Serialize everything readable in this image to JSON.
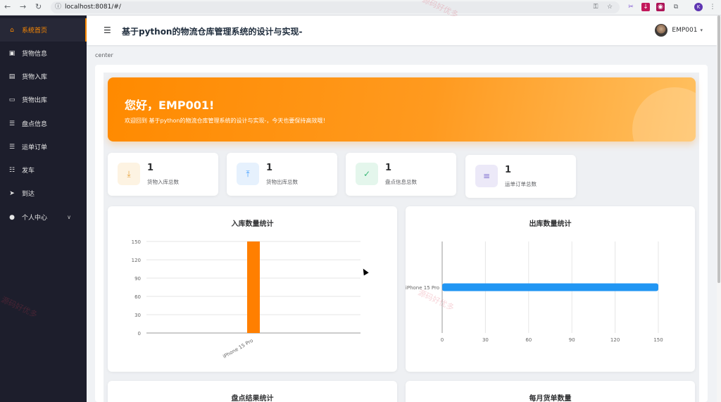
{
  "browser": {
    "url": "localhost:8081/#/",
    "profile_initial": "K"
  },
  "sidebar": {
    "items": [
      {
        "label": "系统首页",
        "icon": "home-icon",
        "active": true
      },
      {
        "label": "货物信息",
        "icon": "briefcase-icon"
      },
      {
        "label": "货物入库",
        "icon": "clipboard-icon"
      },
      {
        "label": "货物出库",
        "icon": "monitor-icon"
      },
      {
        "label": "盘点信息",
        "icon": "list-icon"
      },
      {
        "label": "运单订单",
        "icon": "list-icon"
      },
      {
        "label": "发车",
        "icon": "sliders-icon"
      },
      {
        "label": "到达",
        "icon": "send-icon"
      },
      {
        "label": "个人中心",
        "icon": "user-icon",
        "has_submenu": true
      }
    ]
  },
  "header": {
    "title": "基于python的物流仓库管理系统的设计与实现-",
    "username": "EMP001"
  },
  "breadcrumb": "center",
  "banner": {
    "greeting": "您好，EMP001!",
    "welcome": "欢迎回到 基于python的物流仓库管理系统的设计与实现-，今天也要保持高效哦！"
  },
  "stats": [
    {
      "value": "1",
      "label": "货物入库总数",
      "icon": "download-icon",
      "color": "#e6a23c",
      "bg": "#fdf3e2"
    },
    {
      "value": "1",
      "label": "货物出库总数",
      "icon": "upload-icon",
      "color": "#409eff",
      "bg": "#e6f1fd"
    },
    {
      "value": "1",
      "label": "盘点信息总数",
      "icon": "document-check-icon",
      "color": "#3cb878",
      "bg": "#e4f6ec"
    },
    {
      "value": "1",
      "label": "运单订单总数",
      "icon": "document-icon",
      "color": "#7f6fcf",
      "bg": "#ece9f8"
    }
  ],
  "charts": {
    "inbound_title": "入库数量统计",
    "outbound_title": "出库数量统计",
    "inventory_title": "盘点结果统计",
    "monthly_title": "每月货单数量"
  },
  "chart_data": [
    {
      "type": "bar",
      "title": "入库数量统计",
      "categories": [
        "iPhone 15 Pro"
      ],
      "values": [
        150
      ],
      "ylim": [
        0,
        150
      ],
      "yticks": [
        0,
        30,
        60,
        90,
        120,
        150
      ],
      "color": "#ff7f00",
      "grid": true
    },
    {
      "type": "bar",
      "orientation": "horizontal",
      "title": "出库数量统计",
      "categories": [
        "iPhone 15 Pro"
      ],
      "values": [
        150
      ],
      "xlim": [
        0,
        150
      ],
      "xticks": [
        0,
        30,
        60,
        90,
        120,
        150
      ],
      "color": "#2196f3",
      "grid": true
    }
  ],
  "watermark": "源码好优多"
}
